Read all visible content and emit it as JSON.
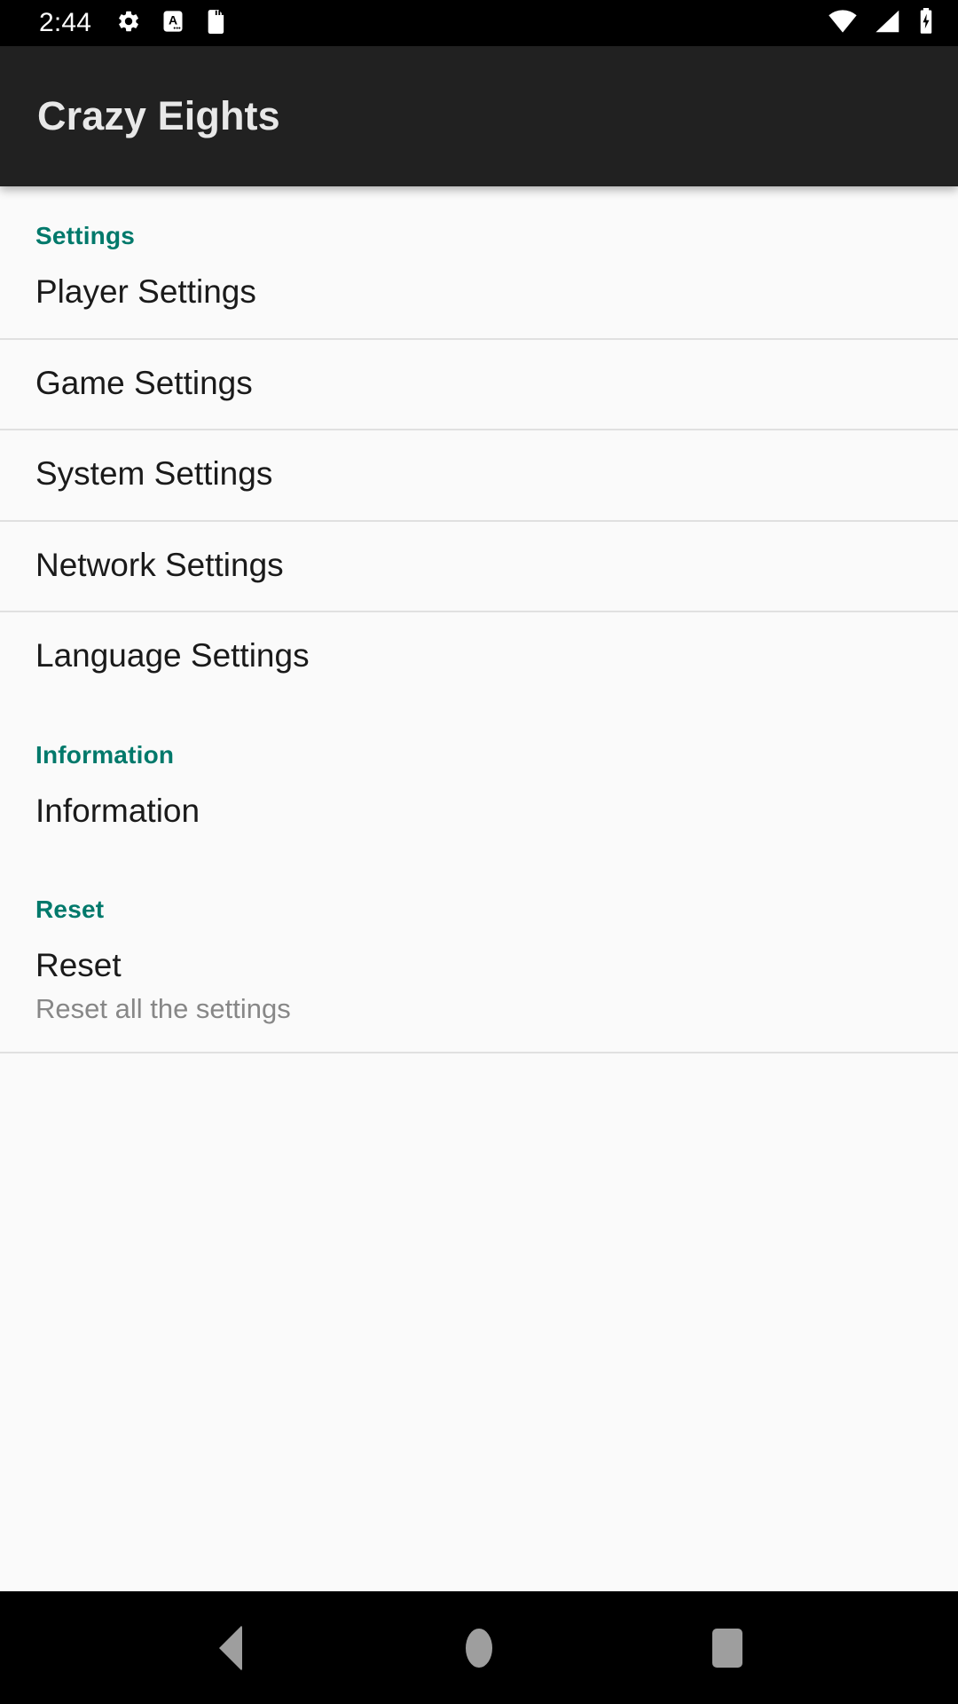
{
  "status_bar": {
    "clock": "2:44",
    "left_icons": [
      "gear-icon",
      "screenshot-a-icon",
      "sd-card-icon"
    ],
    "right_icons": [
      "wifi-icon",
      "cell-signal-icon",
      "battery-charging-icon"
    ]
  },
  "app_bar": {
    "title": "Crazy Eights"
  },
  "theme": {
    "accent": "#00796B",
    "app_bar_bg": "#212121",
    "content_bg": "#FAFAFA",
    "divider": "#E0E0E0",
    "title_text": "#1A1A1A",
    "summary_text": "#878787"
  },
  "preference_groups": [
    {
      "header": "Settings",
      "items": [
        {
          "title": "Player Settings",
          "summary": ""
        },
        {
          "title": "Game Settings",
          "summary": ""
        },
        {
          "title": "System Settings",
          "summary": ""
        },
        {
          "title": "Network Settings",
          "summary": ""
        },
        {
          "title": "Language Settings",
          "summary": ""
        }
      ]
    },
    {
      "header": "Information",
      "items": [
        {
          "title": "Information",
          "summary": ""
        }
      ]
    },
    {
      "header": "Reset",
      "items": [
        {
          "title": "Reset",
          "summary": "Reset all the settings"
        }
      ]
    }
  ],
  "nav_bar": {
    "back_label": "Back",
    "home_label": "Home",
    "recents_label": "Recents"
  }
}
